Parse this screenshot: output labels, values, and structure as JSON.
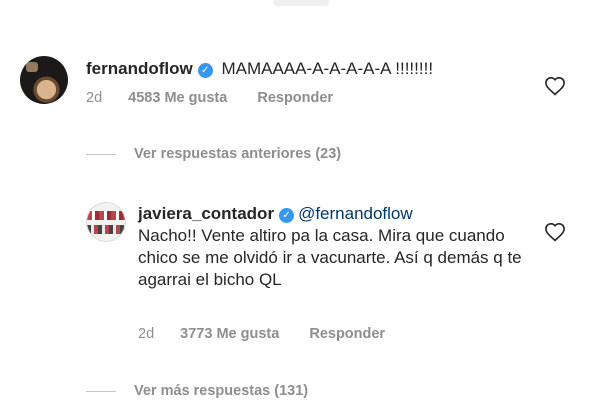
{
  "comments": [
    {
      "username": "fernandoflow",
      "verified": true,
      "text": "MAMAAAA-A-A-A-A-A !!!!!!!!",
      "age": "2d",
      "likes": "4583 Me gusta",
      "reply": "Responder"
    },
    {
      "username": "javiera_contador",
      "verified": true,
      "mention": "@fernandoflow",
      "text": "Nacho!! Vente altiro pa la casa. Mira que cuando chico se me olvidó ir a vacunarte. Así q demás q te agarrai el bicho QL",
      "age": "2d",
      "likes": "3773 Me gusta",
      "reply": "Responder"
    }
  ],
  "threads": {
    "previous_replies": "Ver respuestas anteriores (23)",
    "more_replies": "Ver más respuestas (131)"
  },
  "icons": {
    "like": "heart-outline-icon",
    "verified": "verified-badge-icon"
  },
  "colors": {
    "verified": "#3897f0",
    "mention": "#00376b",
    "meta": "#8e8e8e"
  }
}
